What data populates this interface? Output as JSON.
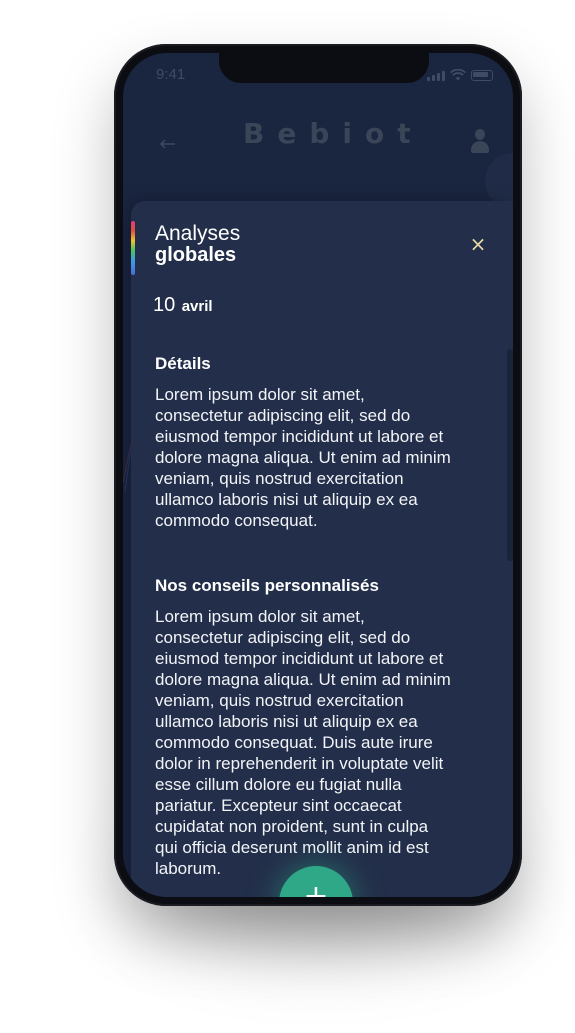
{
  "status_bar": {
    "time": "9:41"
  },
  "header": {
    "logo": "Bebiot",
    "back_icon": "arrow-left-icon",
    "profile_icon": "user-icon"
  },
  "card": {
    "title_light": "Analyses",
    "title_bold": "globales",
    "close_icon": "close-icon",
    "close_label": "×",
    "date_day": "10",
    "date_month": "avril",
    "accent_colors": [
      "#e23c7a",
      "#e0503b",
      "#f1c232",
      "#4fc35c",
      "#3aa0e0",
      "#4b6bd8"
    ],
    "sections": [
      {
        "heading": "Détails",
        "body": "Lorem ipsum dolor sit amet, consectetur adipiscing elit, sed do eiusmod tempor incididunt ut labore et dolore magna aliqua. Ut enim ad minim veniam, quis nostrud exercitation ullamco laboris nisi ut aliquip ex ea commodo consequat."
      },
      {
        "heading": "Nos conseils personnalisés",
        "body": "Lorem ipsum dolor sit amet, consectetur adipiscing elit, sed do eiusmod tempor incididunt ut labore et dolore magna aliqua. Ut enim ad minim veniam, quis nostrud exercitation ullamco laboris nisi ut aliquip ex ea commodo consequat. Duis aute irure dolor in reprehenderit in voluptate velit esse cillum dolore eu fugiat nulla pariatur. Excepteur sint occaecat cupidatat non proident, sunt in culpa qui officia deserunt mollit anim id est laborum."
      }
    ]
  },
  "fab": {
    "label": "+",
    "icon": "plus-icon",
    "color": "#2ea887"
  },
  "colors": {
    "background": "#1a2540",
    "card": "#232f4a",
    "text": "#ffffff",
    "close": "#e9d8a6"
  }
}
